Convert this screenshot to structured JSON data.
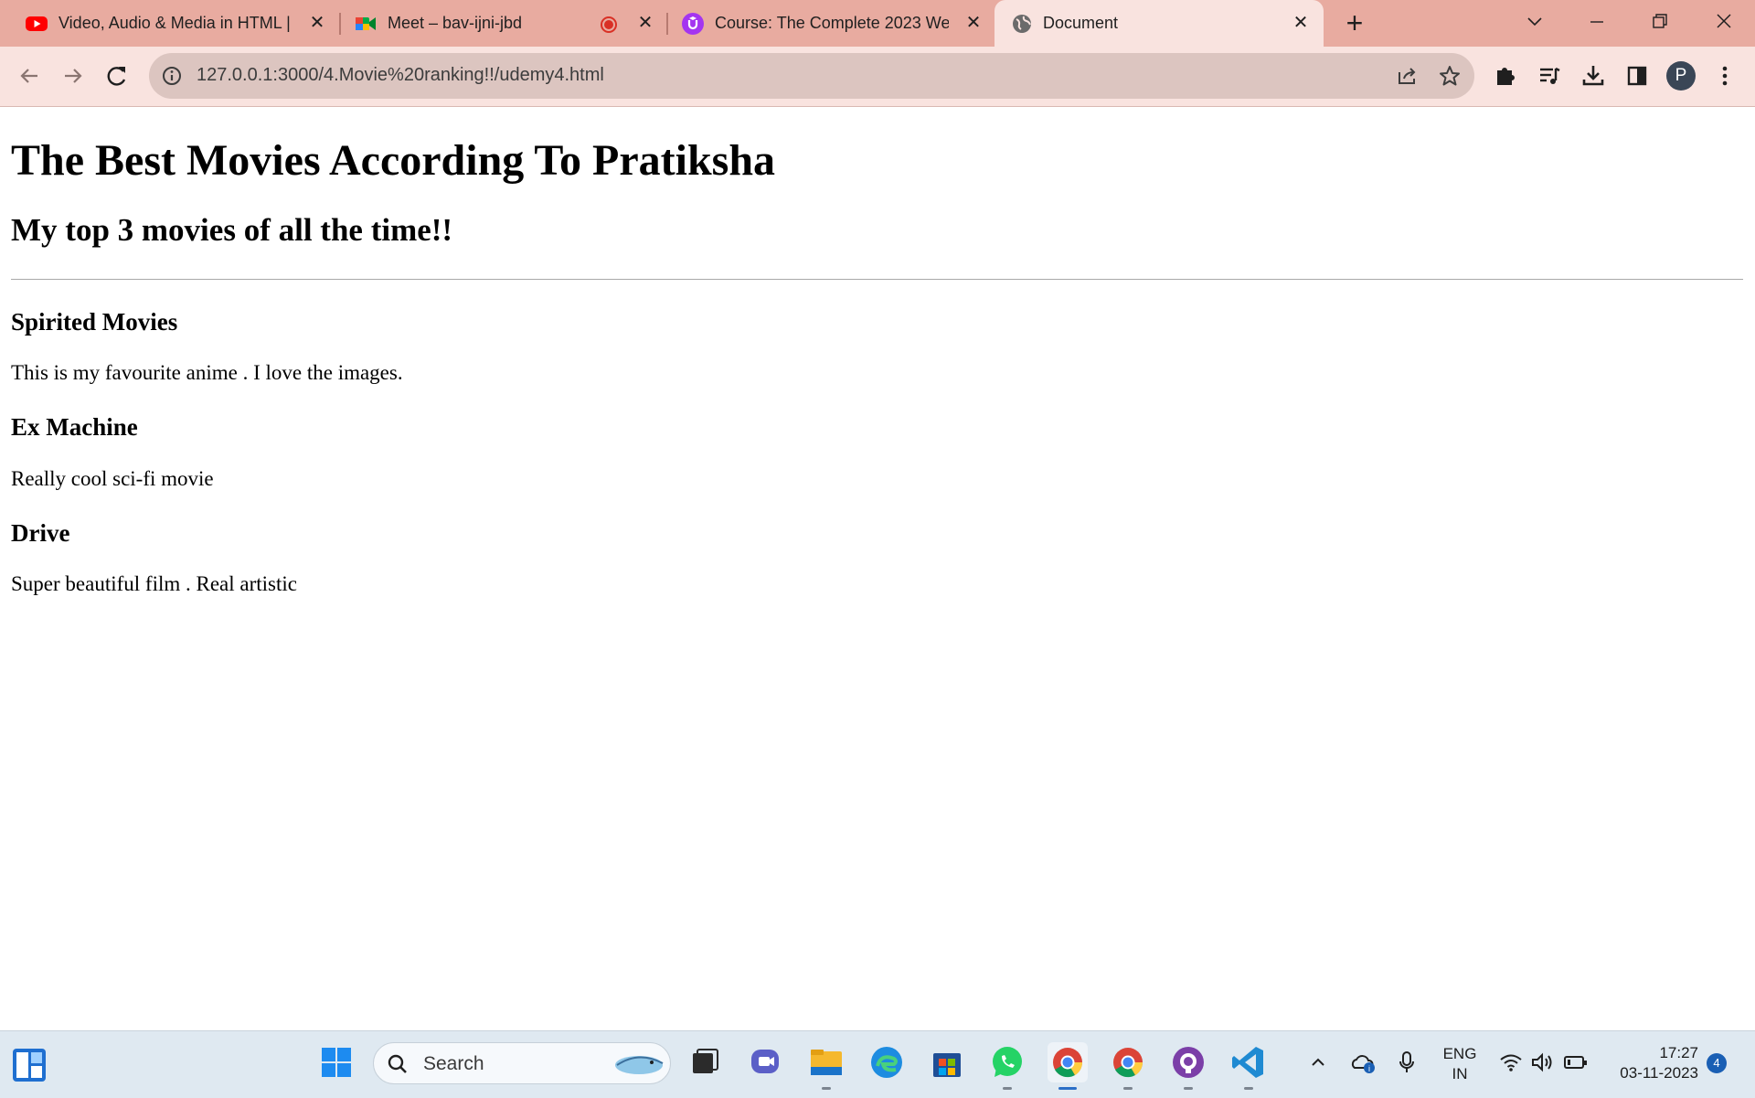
{
  "browser": {
    "tabs": [
      {
        "title": "Video, Audio & Media in HTML |",
        "icon": "youtube-icon",
        "active": false
      },
      {
        "title": "Meet – bav-ijni-jbd",
        "icon": "google-meet-icon",
        "active": false,
        "recording": true
      },
      {
        "title": "Course: The Complete 2023 Web",
        "icon": "udemy-icon",
        "active": false
      },
      {
        "title": "Document",
        "icon": "globe-icon",
        "active": true
      }
    ],
    "url": "127.0.0.1:3000/4.Movie%20ranking!!/udemy4.html",
    "profile_initial": "P",
    "accent_color": "#e8aba0"
  },
  "page": {
    "heading": "The Best Movies According To Pratiksha",
    "subheading": "My top 3 movies of all the time!!",
    "movies": [
      {
        "title": "Spirited Movies",
        "description": "This is my favourite anime . I love the images."
      },
      {
        "title": "Ex Machine",
        "description": "Really cool sci-fi movie"
      },
      {
        "title": "Drive",
        "description": "Super beautiful film . Real artistic"
      }
    ]
  },
  "taskbar": {
    "search_placeholder": "Search",
    "language": "ENG",
    "region": "IN",
    "time": "17:27",
    "date": "03-11-2023",
    "notification_count": "4"
  }
}
